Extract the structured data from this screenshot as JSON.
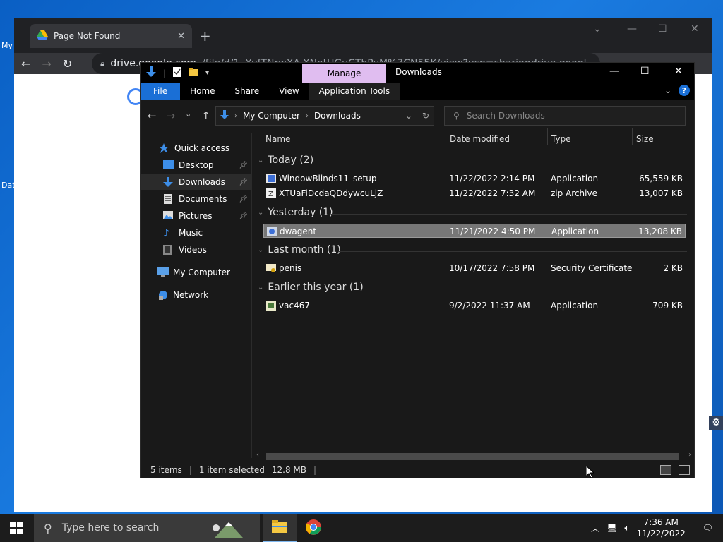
{
  "desktop": {
    "icon_labels": [
      "My",
      "Dat"
    ]
  },
  "chrome": {
    "tab_title": "Page Not Found",
    "tab_close": "✕",
    "new_tab": "+",
    "url_host": "drive.google.com",
    "url_path": "/file/d/1--YvfTNrwXA-XNotUGuCThPyM%7CN55K/view?usp=sharingdrive.googl..."
  },
  "explorer": {
    "manage_tab": "Manage",
    "title": "Downloads",
    "ribbon_tabs": [
      "File",
      "Home",
      "Share",
      "View",
      "Application Tools"
    ],
    "address": [
      "My Computer",
      "Downloads"
    ],
    "search_placeholder": "Search Downloads",
    "nav": [
      {
        "label": "Quick access",
        "icon": "star-icon",
        "pinned": false,
        "selected": false
      },
      {
        "label": "Desktop",
        "icon": "desktop-icon",
        "pinned": true,
        "selected": false
      },
      {
        "label": "Downloads",
        "icon": "download-icon",
        "pinned": true,
        "selected": true
      },
      {
        "label": "Documents",
        "icon": "documents-icon",
        "pinned": true,
        "selected": false
      },
      {
        "label": "Pictures",
        "icon": "pictures-icon",
        "pinned": true,
        "selected": false
      },
      {
        "label": "Music",
        "icon": "music-icon",
        "pinned": false,
        "selected": false
      },
      {
        "label": "Videos",
        "icon": "videos-icon",
        "pinned": false,
        "selected": false
      },
      {
        "label": "My Computer",
        "icon": "computer-icon",
        "pinned": false,
        "selected": false
      },
      {
        "label": "Network",
        "icon": "network-icon",
        "pinned": false,
        "selected": false
      }
    ],
    "columns": [
      "Name",
      "Date modified",
      "Type",
      "Size"
    ],
    "groups": [
      {
        "label": "Today (2)",
        "files": [
          {
            "name": "WindowBlinds11_setup",
            "date": "11/22/2022 2:14 PM",
            "type": "Application",
            "size": "65,559 KB",
            "selected": false
          },
          {
            "name": "XTUaFiDcdaQDdywcuLjZ",
            "date": "11/22/2022 7:32 AM",
            "type": "zip Archive",
            "size": "13,007 KB",
            "selected": false
          }
        ]
      },
      {
        "label": "Yesterday (1)",
        "files": [
          {
            "name": "dwagent",
            "date": "11/21/2022 4:50 PM",
            "type": "Application",
            "size": "13,208 KB",
            "selected": true
          }
        ]
      },
      {
        "label": "Last month (1)",
        "files": [
          {
            "name": "penis",
            "date": "10/17/2022 7:58 PM",
            "type": "Security Certificate",
            "size": "2 KB",
            "selected": false
          }
        ]
      },
      {
        "label": "Earlier this year (1)",
        "files": [
          {
            "name": "vac467",
            "date": "9/2/2022 11:37 AM",
            "type": "Application",
            "size": "709 KB",
            "selected": false
          }
        ]
      }
    ],
    "status": {
      "items": "5 items",
      "selected": "1 item selected",
      "size": "12.8 MB"
    }
  },
  "taskbar": {
    "search_placeholder": "Type here to search",
    "time": "7:36 AM",
    "date": "11/22/2022"
  },
  "colors": {
    "manage_accent": "#e0bdf0",
    "file_tab": "#1a6fd6",
    "selection": "#777777"
  }
}
